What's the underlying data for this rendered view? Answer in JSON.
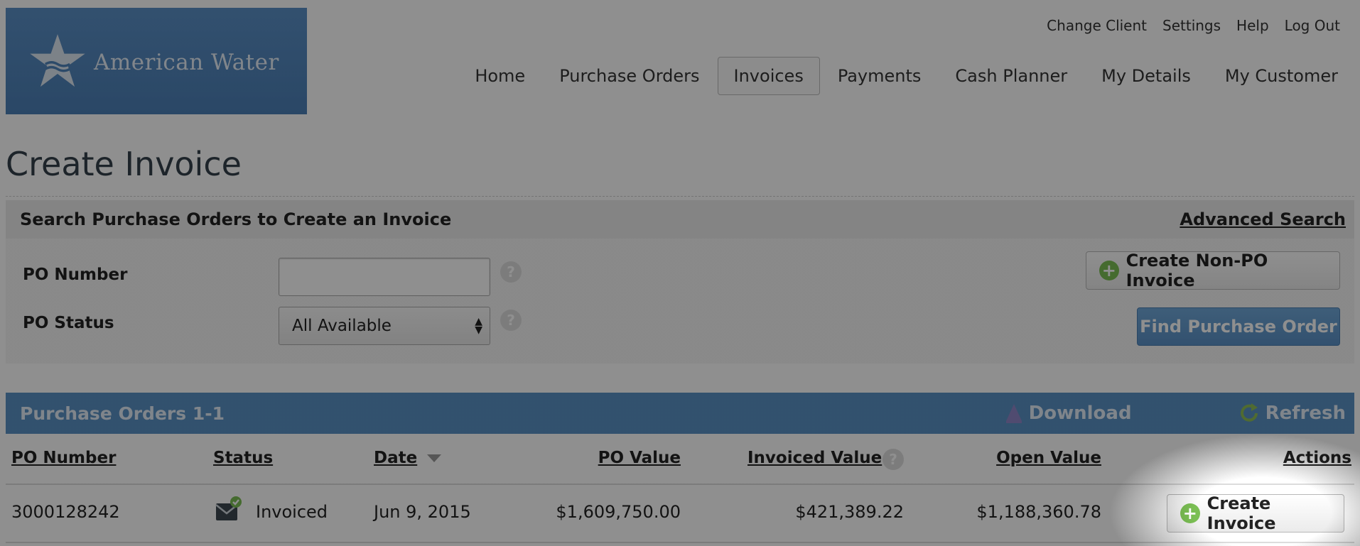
{
  "logo": {
    "text": "American Water",
    "icon": "star-wave-icon"
  },
  "utility_nav": [
    "Change Client",
    "Settings",
    "Help",
    "Log Out"
  ],
  "main_nav": {
    "items": [
      "Home",
      "Purchase Orders",
      "Invoices",
      "Payments",
      "Cash Planner",
      "My Details",
      "My Customer"
    ],
    "active": "Invoices"
  },
  "page": {
    "title": "Create Invoice"
  },
  "search": {
    "title": "Search Purchase Orders to Create an Invoice",
    "advanced_link": "Advanced Search",
    "po_number_label": "PO Number",
    "po_number_value": "",
    "po_status_label": "PO Status",
    "po_status_value": "All Available",
    "help_icon": "question-icon",
    "create_non_po_label": "Create Non-PO Invoice",
    "find_label": "Find Purchase Order"
  },
  "results": {
    "title": "Purchase Orders 1-1",
    "download_label": "Download",
    "refresh_label": "Refresh",
    "columns": [
      "PO Number",
      "Status",
      "Date",
      "PO Value",
      "Invoiced Value",
      "Open Value",
      "Actions"
    ],
    "rows": [
      {
        "po_number": "3000128242",
        "status": "Invoiced",
        "date": "Jun 9, 2015",
        "po_value": "$1,609,750.00",
        "invoiced_value": "$421,389.22",
        "open_value": "$1,188,360.78",
        "action": "Create Invoice"
      }
    ]
  },
  "colors": {
    "overlay": "#000000",
    "accent_blue": "#5a91c4",
    "plus_green": "#7bbf54"
  }
}
